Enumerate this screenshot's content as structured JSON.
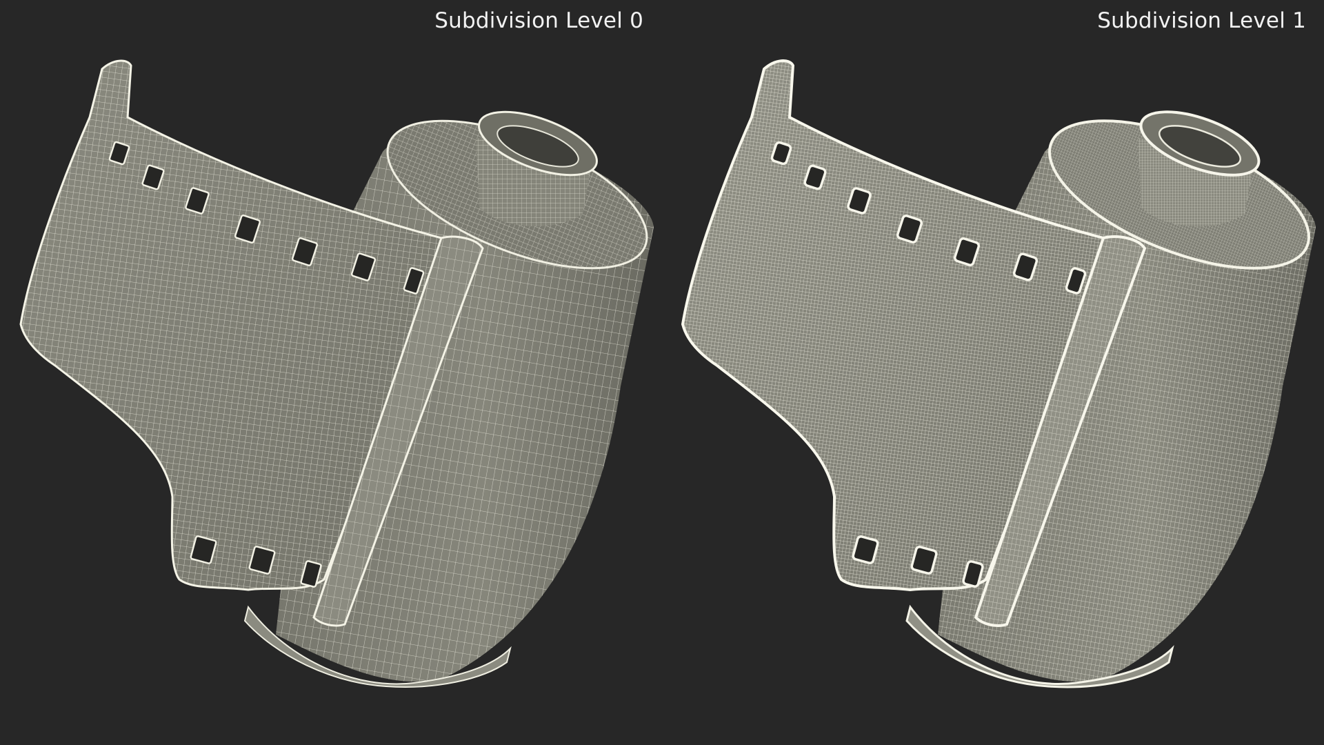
{
  "panels": [
    {
      "id": "level0",
      "label": "Subdivision Level 0",
      "wire_color": "#f2f1e4",
      "surface_color": "#7d7d72"
    },
    {
      "id": "level1",
      "label": "Subdivision Level 1",
      "wire_color": "#f6f5ea",
      "surface_color": "#818176"
    }
  ],
  "background_color": "#272727"
}
